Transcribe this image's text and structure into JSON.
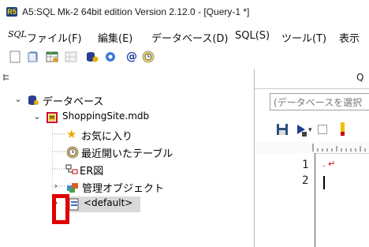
{
  "window": {
    "title": "A5:SQL Mk-2 64bit edition Version 2.12.0 - [Query-1 *]",
    "app_icon_text": "R5"
  },
  "menu": {
    "logo": "SQL",
    "items": [
      {
        "label": "ファイル(F)"
      },
      {
        "label": "編集(E)"
      },
      {
        "label": "データベース(D)"
      },
      {
        "label": "SQL(S)"
      },
      {
        "label": "ツール(T)"
      },
      {
        "label": "表示"
      }
    ]
  },
  "tree": {
    "root": {
      "label": "データベース"
    },
    "db": {
      "label": "ShoppingSite.mdb"
    },
    "children": [
      {
        "label": "お気に入り"
      },
      {
        "label": "最近開いたテーブル"
      },
      {
        "label": "ER図"
      },
      {
        "label": "管理オブジェクト"
      },
      {
        "label": "<default>"
      }
    ]
  },
  "right": {
    "tab_label": "Q",
    "combo_text": "(データベースを選択",
    "line_numbers": [
      "1",
      "2"
    ],
    "editor_line1": ". ↵"
  },
  "colors": {
    "highlight": "#e00000",
    "selection": "#d9d9d9"
  }
}
